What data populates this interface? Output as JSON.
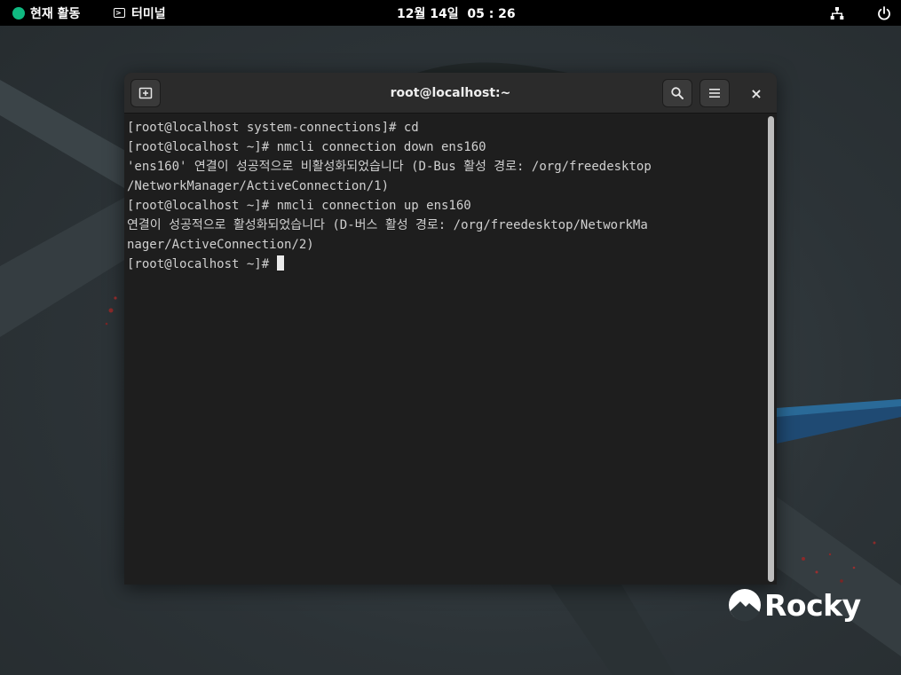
{
  "topbar": {
    "activities_label": "현재 활동",
    "app_name": "터미널",
    "clock": "12월 14일  05 : 26",
    "icons": {
      "network": "network-wired-icon",
      "power": "power-icon"
    }
  },
  "window": {
    "title": "root@localhost:~",
    "icons": {
      "new_tab": "new-tab-icon",
      "search": "search-icon",
      "menu": "hamburger-menu-icon",
      "close": "close-icon"
    },
    "close_glyph": "×"
  },
  "terminal": {
    "lines": [
      "[root@localhost system-connections]# cd",
      "[root@localhost ~]# nmcli connection down ens160",
      "'ens160' 연결이 성공적으로 비활성화되었습니다 (D-Bus 활성 경로: /org/freedesktop",
      "/NetworkManager/ActiveConnection/1)",
      "[root@localhost ~]# nmcli connection up ens160",
      "연결이 성공적으로 활성화되었습니다 (D-버스 활성 경로: /org/freedesktop/NetworkMa",
      "nager/ActiveConnection/2)",
      "[root@localhost ~]# "
    ]
  },
  "branding": {
    "logo_text": "Rocky"
  },
  "colors": {
    "topbar_bg": "#000000",
    "terminal_bg": "#1e1e1e",
    "headerbar_bg": "#2b2b2b",
    "accent_green": "#10b981",
    "text": "#d0d0d0"
  }
}
